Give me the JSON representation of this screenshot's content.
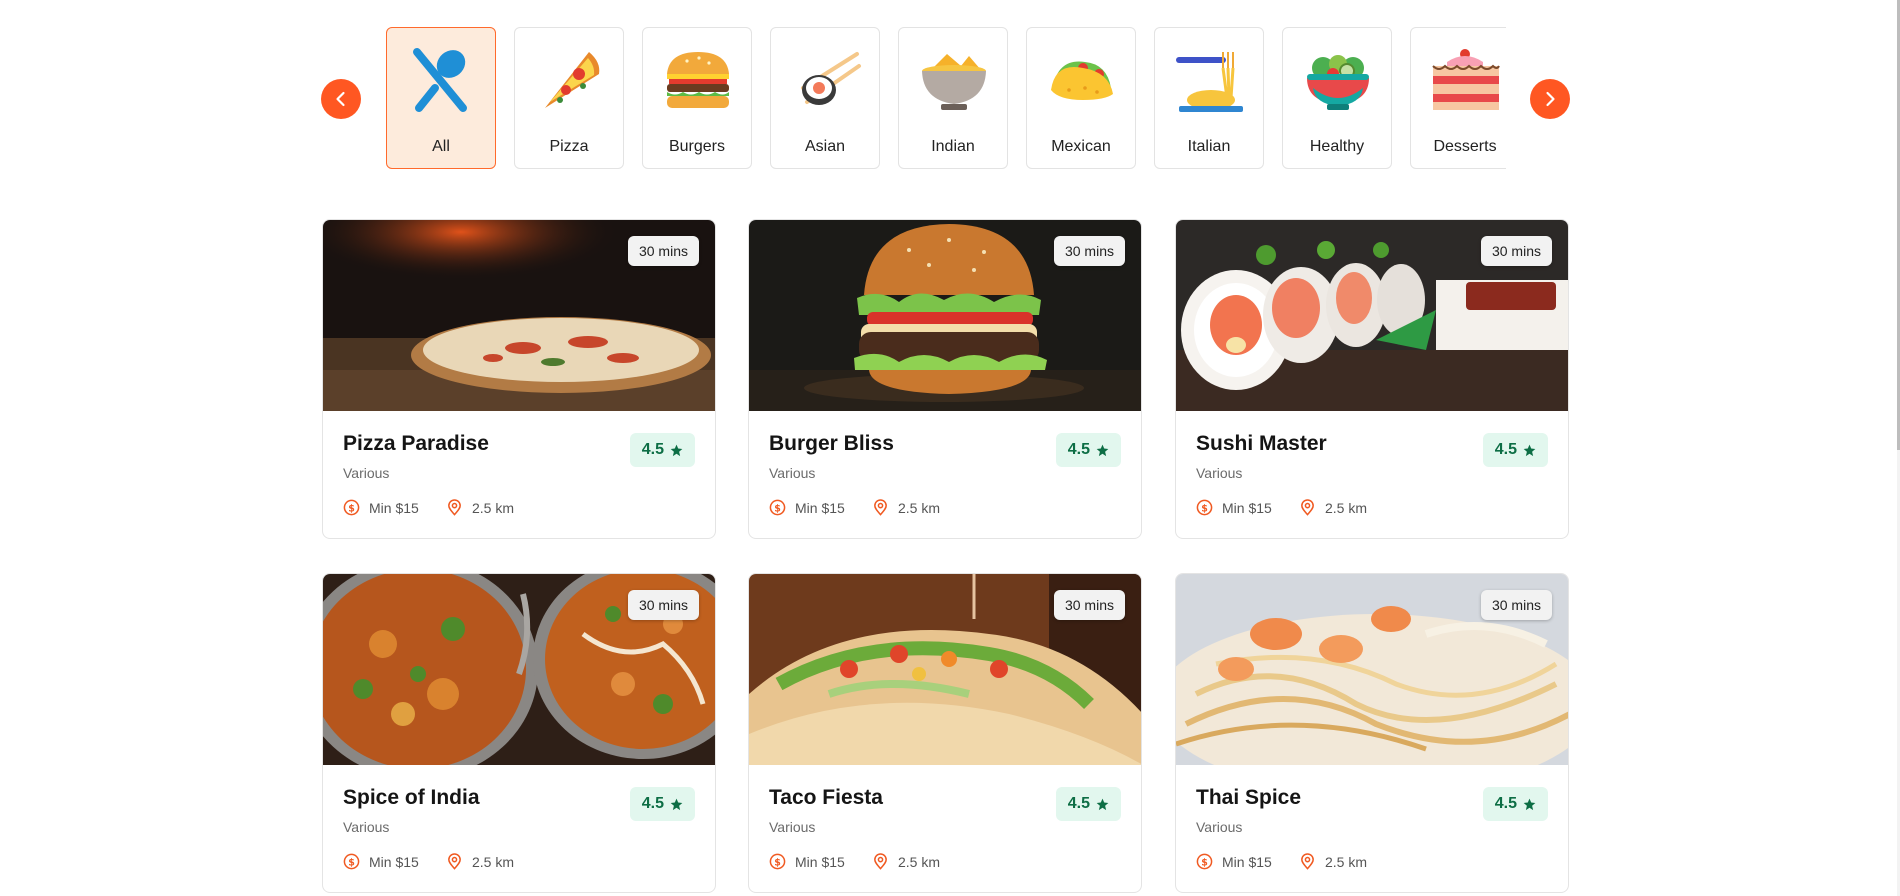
{
  "categories": [
    {
      "label": "All",
      "icon": "cutlery-icon",
      "active": true
    },
    {
      "label": "Pizza",
      "icon": "pizza-icon"
    },
    {
      "label": "Burgers",
      "icon": "burger-icon"
    },
    {
      "label": "Asian",
      "icon": "sushi-icon"
    },
    {
      "label": "Indian",
      "icon": "curry-bowl-icon"
    },
    {
      "label": "Mexican",
      "icon": "taco-icon"
    },
    {
      "label": "Italian",
      "icon": "pasta-icon"
    },
    {
      "label": "Healthy",
      "icon": "salad-icon"
    },
    {
      "label": "Desserts",
      "icon": "cake-icon"
    }
  ],
  "nav": {
    "prev_icon": "chevron-left-icon",
    "next_icon": "chevron-right-icon"
  },
  "restaurants": [
    {
      "name": "Pizza Paradise",
      "cuisine": "Various",
      "rating": "4.5",
      "time": "30 mins",
      "min_order": "Min $15",
      "distance": "2.5 km",
      "image": "pizza-photo"
    },
    {
      "name": "Burger Bliss",
      "cuisine": "Various",
      "rating": "4.5",
      "time": "30 mins",
      "min_order": "Min $15",
      "distance": "2.5 km",
      "image": "burger-photo"
    },
    {
      "name": "Sushi Master",
      "cuisine": "Various",
      "rating": "4.5",
      "time": "30 mins",
      "min_order": "Min $15",
      "distance": "2.5 km",
      "image": "sushi-photo"
    },
    {
      "name": "Spice of India",
      "cuisine": "Various",
      "rating": "4.5",
      "time": "30 mins",
      "min_order": "Min $15",
      "distance": "2.5 km",
      "image": "curry-photo"
    },
    {
      "name": "Taco Fiesta",
      "cuisine": "Various",
      "rating": "4.5",
      "time": "30 mins",
      "min_order": "Min $15",
      "distance": "2.5 km",
      "image": "taco-photo"
    },
    {
      "name": "Thai Spice",
      "cuisine": "Various",
      "rating": "4.5",
      "time": "30 mins",
      "min_order": "Min $15",
      "distance": "2.5 km",
      "image": "noodles-photo"
    }
  ],
  "colors": {
    "accent": "#ff5722",
    "active_bg": "#fdebdc",
    "rating_bg": "#e2f7ee",
    "rating_text": "#0d6e45"
  }
}
